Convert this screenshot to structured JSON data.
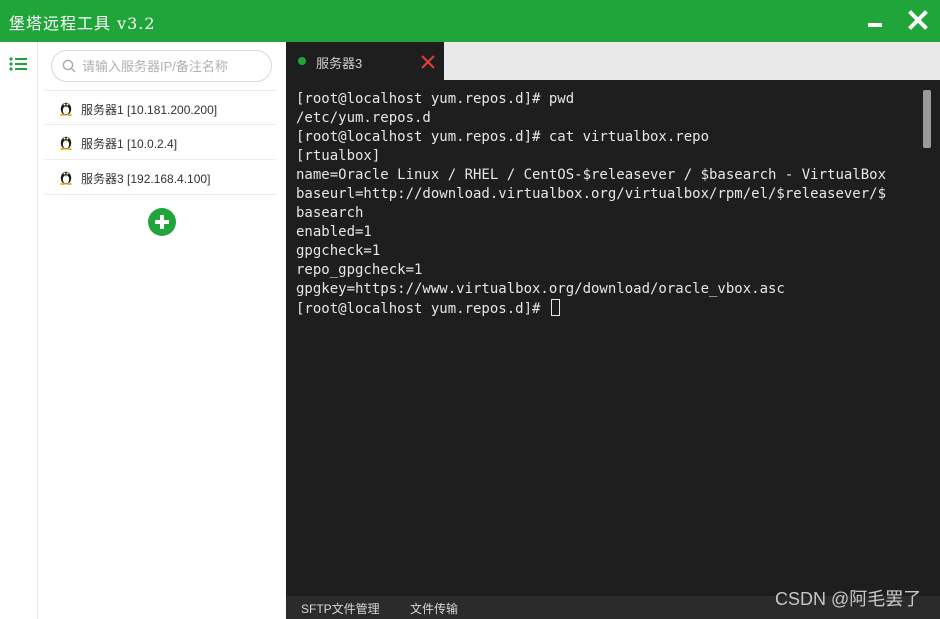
{
  "window": {
    "title": "堡塔远程工具 v3.2",
    "accent_color": "#20a53a"
  },
  "rail": {
    "list_icon": "list-icon"
  },
  "search": {
    "placeholder": "请输入服务器IP/备注名称",
    "value": ""
  },
  "servers": [
    {
      "label": "服务器1 [10.181.200.200]",
      "icon": "linux-tux-icon"
    },
    {
      "label": "服务器1 [10.0.2.4]",
      "icon": "linux-tux-icon"
    },
    {
      "label": "服务器3 [192.168.4.100]",
      "icon": "linux-tux-icon"
    }
  ],
  "add_button_icon": "plus-icon",
  "tabs": [
    {
      "label": "服务器3",
      "status_color": "#20a53a",
      "close_color": "#e33d3d"
    }
  ],
  "terminal": {
    "lines": [
      "[root@localhost yum.repos.d]# pwd",
      "/etc/yum.repos.d",
      "[root@localhost yum.repos.d]# cat virtualbox.repo",
      "[rtualbox]",
      "name=Oracle Linux / RHEL / CentOS-$releasever / $basearch - VirtualBox",
      "baseurl=http://download.virtualbox.org/virtualbox/rpm/el/$releasever/$",
      "basearch",
      "enabled=1",
      "gpgcheck=1",
      "repo_gpgcheck=1",
      "gpgkey=https://www.virtualbox.org/download/oracle_vbox.asc",
      "[root@localhost yum.repos.d]# "
    ]
  },
  "bottom": {
    "sftp_label": "SFTP文件管理",
    "transfer_label": "文件传输"
  },
  "watermark": "CSDN @阿毛罢了"
}
